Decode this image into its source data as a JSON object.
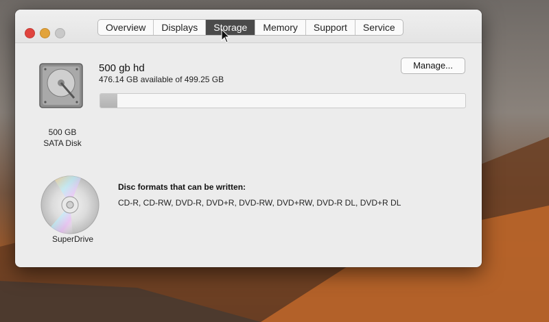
{
  "window": {
    "tabs": [
      {
        "label": "Overview",
        "active": false
      },
      {
        "label": "Displays",
        "active": false
      },
      {
        "label": "Storage",
        "active": true
      },
      {
        "label": "Memory",
        "active": false
      },
      {
        "label": "Support",
        "active": false
      },
      {
        "label": "Service",
        "active": false
      }
    ]
  },
  "storage": {
    "disk_name": "500 gb hd",
    "disk_available": "476.14 GB available of 499.25 GB",
    "used_fraction": 0.0463,
    "manage_label": "Manage...",
    "disk_caption_line1": "500 GB",
    "disk_caption_line2": "SATA Disk"
  },
  "superdrive": {
    "caption": "SuperDrive",
    "formats_title": "Disc formats that can be written:",
    "formats_list": "CD-R, CD-RW, DVD-R, DVD+R, DVD-RW, DVD+RW, DVD-R DL, DVD+R DL"
  },
  "icons": {
    "close": "close-icon",
    "minimize": "minimize-icon",
    "maximize": "maximize-icon",
    "disk": "hard-disk-icon",
    "disc": "optical-disc-icon",
    "cursor": "cursor-icon"
  },
  "colors": {
    "active_tab": "#4a4a4a",
    "close": "#e0443e",
    "minimize": "#e2a33b",
    "maximize_disabled": "#c9c9c9"
  }
}
